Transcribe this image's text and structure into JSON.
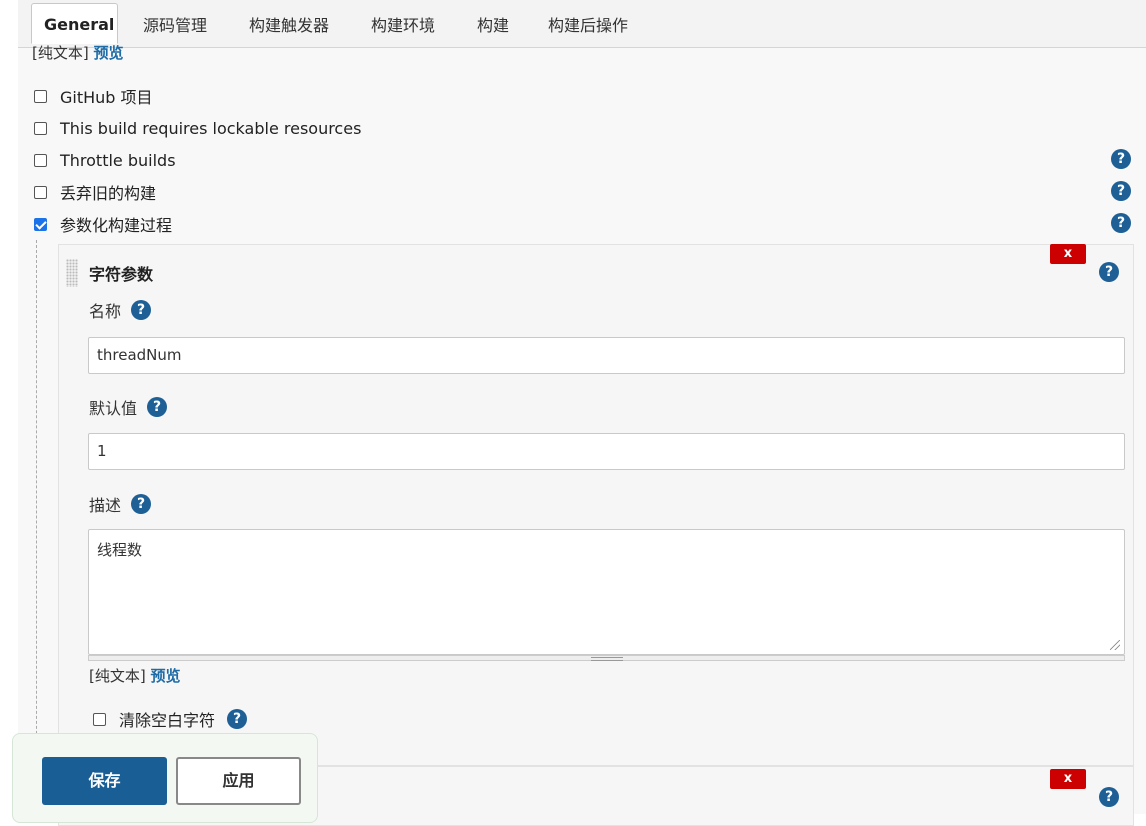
{
  "tabs": [
    "General",
    "源码管理",
    "构建触发器",
    "构建环境",
    "构建",
    "构建后操作"
  ],
  "top_plain": {
    "text": "[纯文本]",
    "preview": "预览"
  },
  "options": [
    {
      "label": "GitHub 项目",
      "checked": false
    },
    {
      "label": "This build requires lockable resources",
      "checked": false
    },
    {
      "label": "Throttle builds",
      "checked": false
    },
    {
      "label": "丢弃旧的构建",
      "checked": false
    },
    {
      "label": "参数化构建过程",
      "checked": true
    }
  ],
  "param": {
    "title": "字符参数",
    "delete_label": "x",
    "name_label": "名称",
    "name_value": "threadNum",
    "default_label": "默认值",
    "default_value": "1",
    "desc_label": "描述",
    "desc_value": "线程数",
    "plain_text": "[纯文本]",
    "preview": "预览",
    "trim_label": "清除空白字符"
  },
  "help_glyph": "?",
  "buttons": {
    "save": "保存",
    "apply": "应用"
  }
}
